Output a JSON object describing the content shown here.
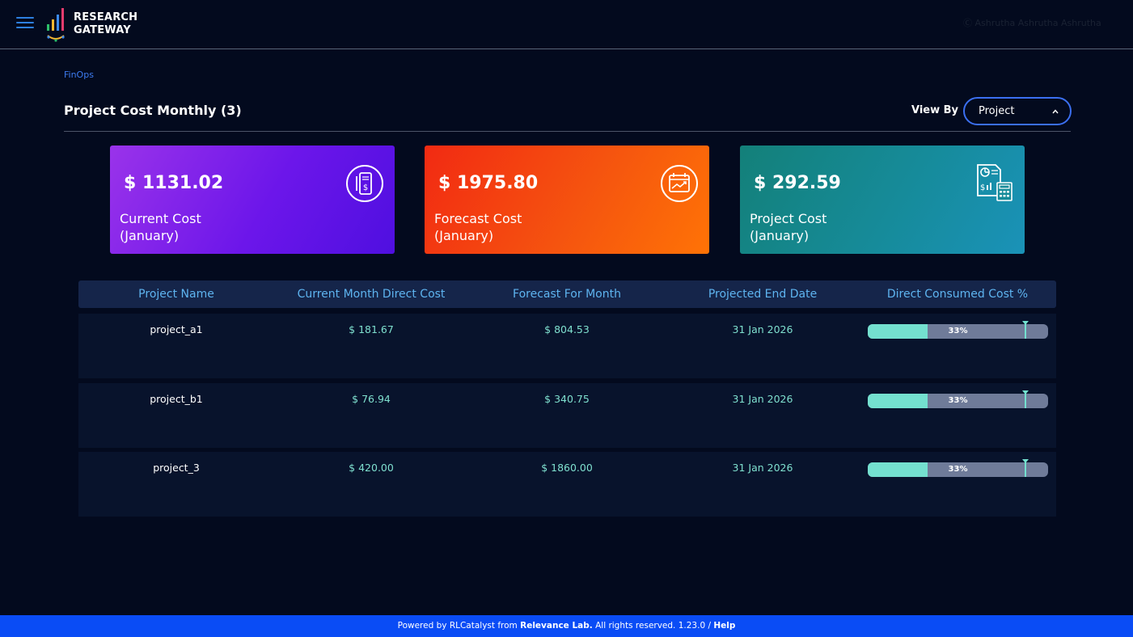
{
  "header": {
    "logo_line1": "RESEARCH",
    "logo_line2": "GATEWAY",
    "logo_bar_colors": [
      "#2dbf6a",
      "#f7b731",
      "#3b8bf0",
      "#e63c6e"
    ],
    "user_info": "Ⓒ Ashrutha Ashrutha Ashrutha"
  },
  "breadcrumb": "FinOps",
  "page": {
    "title": "Project Cost Monthly (3)",
    "view_by_label": "View By",
    "view_by_value": "Project"
  },
  "cards": [
    {
      "amount": "$ 1131.02",
      "label_line1": "Current Cost",
      "label_line2": "(January)",
      "icon": "receipt-dollar-icon"
    },
    {
      "amount": "$ 1975.80",
      "label_line1": "Forecast Cost",
      "label_line2": "(January)",
      "icon": "calendar-trend-icon"
    },
    {
      "amount": "$ 292.59",
      "label_line1": "Project Cost",
      "label_line2": "(January)",
      "icon": "report-calculator-icon"
    }
  ],
  "table": {
    "columns": [
      "Project Name",
      "Current Month Direct Cost",
      "Forecast For Month",
      "Projected End Date",
      "Direct Consumed Cost %"
    ],
    "rows": [
      {
        "name": "project_a1",
        "current": "$ 181.67",
        "forecast": "$ 804.53",
        "end_date": "31 Jan 2026",
        "consumed_pct": "33%",
        "consumed_value": 33
      },
      {
        "name": "project_b1",
        "current": "$ 76.94",
        "forecast": "$ 340.75",
        "end_date": "31 Jan 2026",
        "consumed_pct": "33%",
        "consumed_value": 33
      },
      {
        "name": "project_3",
        "current": "$ 420.00",
        "forecast": "$ 1860.00",
        "end_date": "31 Jan 2026",
        "consumed_pct": "33%",
        "consumed_value": 33
      }
    ]
  },
  "footer": {
    "prefix": "Powered by RLCatalyst from ",
    "company": "Relevance Lab.",
    "middle": " All rights reserved. 1.23.0 / ",
    "help": "Help"
  },
  "colors": {
    "background": "#030a1e",
    "accent": "#3b6ff0",
    "table_header": "#15254a",
    "row": "#08132c",
    "value_text": "#7fe0cf",
    "footer": "#0a4cf5"
  }
}
